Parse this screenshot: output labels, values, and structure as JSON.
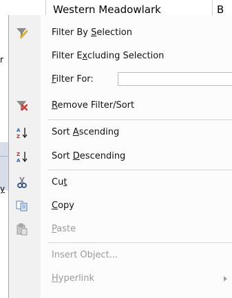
{
  "background": {
    "top_cell_text": "Western Meadowlark",
    "top_cell_right_text": "B",
    "left_fragments": [
      "r",
      "y"
    ]
  },
  "menu": {
    "items": [
      {
        "icon": "filter-by-selection-icon",
        "label_pre": "Filter By ",
        "label_acc": "S",
        "label_post": "election",
        "enabled": true
      },
      {
        "icon": "",
        "label_pre": "Filter E",
        "label_acc": "x",
        "label_post": "cluding Selection",
        "enabled": true
      },
      {
        "icon": "",
        "label_pre": "",
        "label_acc": "F",
        "label_post": "ilter For:",
        "enabled": true,
        "input_value": "",
        "input_placeholder": ""
      },
      {
        "icon": "remove-filter-icon",
        "label_pre": "",
        "label_acc": "R",
        "label_post": "emove Filter/Sort",
        "enabled": true
      },
      {
        "icon": "sort-ascending-icon",
        "label_pre": "Sort ",
        "label_acc": "A",
        "label_post": "scending",
        "enabled": true
      },
      {
        "icon": "sort-descending-icon",
        "label_pre": "Sort ",
        "label_acc": "D",
        "label_post": "escending",
        "enabled": true
      },
      {
        "icon": "cut-icon",
        "label_pre": "Cu",
        "label_acc": "t",
        "label_post": "",
        "enabled": true
      },
      {
        "icon": "copy-icon",
        "label_pre": "",
        "label_acc": "C",
        "label_post": "opy",
        "enabled": true
      },
      {
        "icon": "paste-icon",
        "label_pre": "",
        "label_acc": "P",
        "label_post": "aste",
        "enabled": false
      },
      {
        "icon": "",
        "label_pre": "Insert Object...",
        "label_acc": "",
        "label_post": "",
        "enabled": false
      },
      {
        "icon": "",
        "label_pre": "",
        "label_acc": "H",
        "label_post": "yperlink",
        "enabled": false
      }
    ]
  },
  "colors": {
    "menu_bg": "#fcfcfc",
    "gutter_bg": "#f1f1f1",
    "disabled_text": "#9a9a9a"
  }
}
